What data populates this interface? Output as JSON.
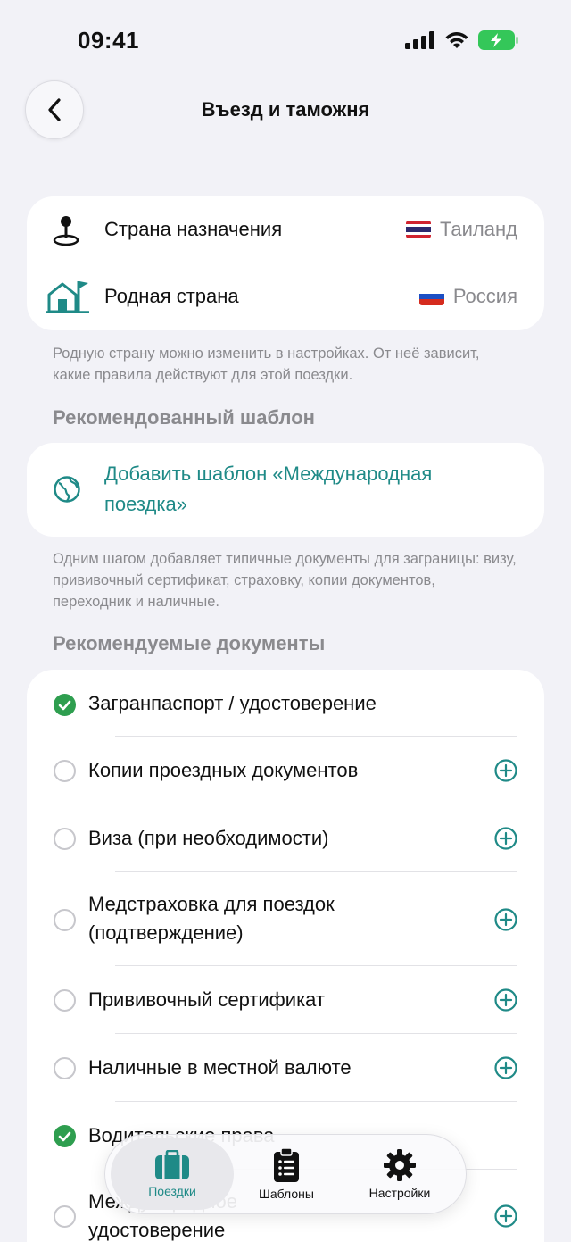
{
  "status": {
    "time": "09:41"
  },
  "header": {
    "title": "Въезд и таможня"
  },
  "countries": {
    "destination": {
      "label": "Страна назначения",
      "value": "Таиланд"
    },
    "home": {
      "label": "Родная страна",
      "value": "Россия"
    },
    "caption": "Родную страну можно изменить в настройках. От неё зависит, какие правила действуют для этой поездки."
  },
  "recommended_template": {
    "section_title": "Рекомендованный шаблон",
    "action_label": "Добавить шаблон «Международная поездка»",
    "caption": "Одним шагом добавляет типичные документы для заграницы: визу, прививочный сертификат, страховку, копии документов, переходник и наличные."
  },
  "documents": {
    "section_title": "Рекомендуемые документы",
    "items": [
      {
        "label": "Загранпаспорт / удостоверение",
        "checked": true
      },
      {
        "label": "Копии проездных документов",
        "checked": false
      },
      {
        "label": "Виза (при необходимости)",
        "checked": false
      },
      {
        "label": "Медстраховка для поездок (подтверждение)",
        "checked": false
      },
      {
        "label": "Прививочный сертификат",
        "checked": false
      },
      {
        "label": "Наличные в местной валюте",
        "checked": false
      },
      {
        "label": "Водительские права",
        "checked": true
      },
      {
        "label": "Международное удостоверение",
        "checked": false
      }
    ]
  },
  "tabbar": {
    "tabs": [
      {
        "label": "Поездки",
        "active": true
      },
      {
        "label": "Шаблоны",
        "active": false
      },
      {
        "label": "Настройки",
        "active": false
      }
    ]
  },
  "colors": {
    "accent": "#1f8a87",
    "check": "#2e9e4f",
    "background": "#f2f2f7"
  }
}
